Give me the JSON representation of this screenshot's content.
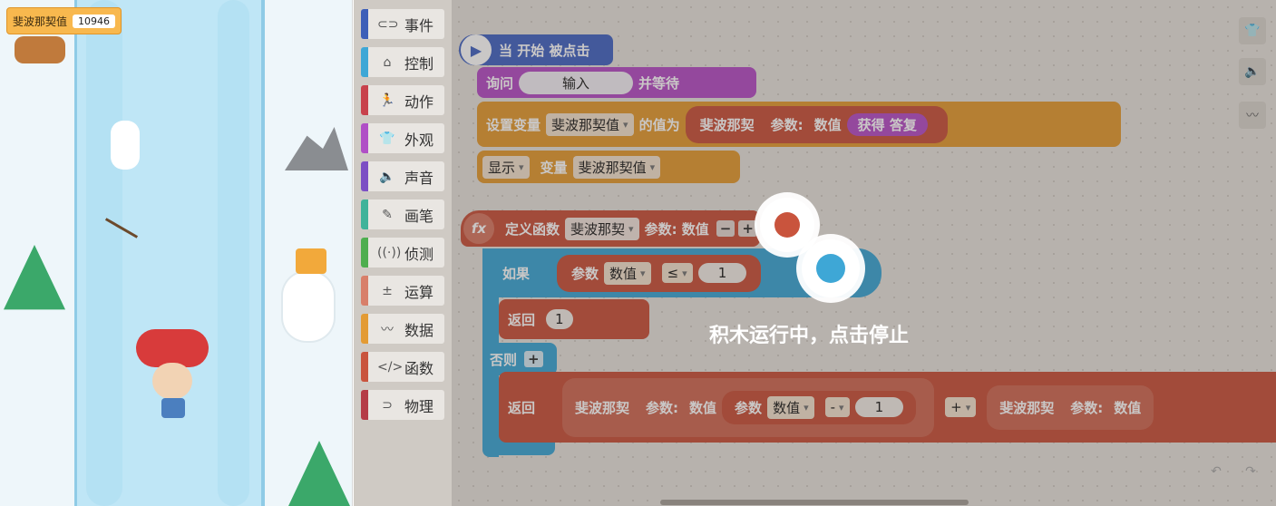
{
  "stage": {
    "variable_monitor": {
      "name": "斐波那契值",
      "value": "10946"
    }
  },
  "categories": [
    {
      "label": "事件",
      "icon": "toggle-icon",
      "glyph": "⊂⊃",
      "color": "#3d5fb8"
    },
    {
      "label": "控制",
      "icon": "gamepad-icon",
      "glyph": "⌂",
      "color": "#3ea7d6"
    },
    {
      "label": "动作",
      "icon": "running-person-icon",
      "glyph": "🏃",
      "color": "#c8424c"
    },
    {
      "label": "外观",
      "icon": "shirt-icon",
      "glyph": "👕",
      "color": "#b04fc6"
    },
    {
      "label": "声音",
      "icon": "speaker-icon",
      "glyph": "🔈",
      "color": "#7c4fc4"
    },
    {
      "label": "画笔",
      "icon": "pencil-icon",
      "glyph": "✎",
      "color": "#3fb39a"
    },
    {
      "label": "侦测",
      "icon": "radar-icon",
      "glyph": "((·))",
      "color": "#4eae4f"
    },
    {
      "label": "运算",
      "icon": "calculator-icon",
      "glyph": "±",
      "color": "#d87f6a"
    },
    {
      "label": "数据",
      "icon": "chart-line-icon",
      "glyph": "〰",
      "color": "#e39b34"
    },
    {
      "label": "函数",
      "icon": "code-icon",
      "glyph": "</>",
      "color": "#c9543d"
    },
    {
      "label": "物理",
      "icon": "magnet-icon",
      "glyph": "⊃",
      "color": "#b53c47"
    }
  ],
  "blocks": {
    "event": {
      "label": "当 开始 被点击"
    },
    "ask": {
      "prefix": "询问",
      "input": "输入",
      "suffix": "并等待"
    },
    "set_var": {
      "prefix": "设置变量",
      "var": "斐波那契值",
      "mid": "的值为",
      "func": "斐波那契",
      "param_label": "参数:",
      "param_name": "数值",
      "answer": "获得 答复"
    },
    "show_var": {
      "prefix": "显示",
      "mid": "变量",
      "var": "斐波那契值"
    },
    "define": {
      "prefix": "定义函数",
      "name": "斐波那契",
      "param": "参数: 数值",
      "minus": "−",
      "plus": "+"
    },
    "if": {
      "label": "如果",
      "param": "参数",
      "param_name": "数值",
      "op": "≤",
      "value": "1"
    },
    "return1": {
      "label": "返回",
      "value": "1"
    },
    "else": {
      "label": "否则",
      "plus": "+"
    },
    "return2": {
      "label": "返回",
      "func": "斐波那契",
      "param_label": "参数:",
      "param_name": "数值",
      "inner_param": "参数",
      "inner_name": "数值",
      "minus": "-",
      "minus_value": "1",
      "plus": "+",
      "func2": "斐波那契",
      "param_label2": "参数:",
      "param_name2": "数值"
    }
  },
  "overlay": {
    "message": "积木运行中，点击停止"
  },
  "toolbar": {
    "costume": "shirt-icon",
    "sound": "speaker-icon",
    "data": "chart-line-icon"
  }
}
